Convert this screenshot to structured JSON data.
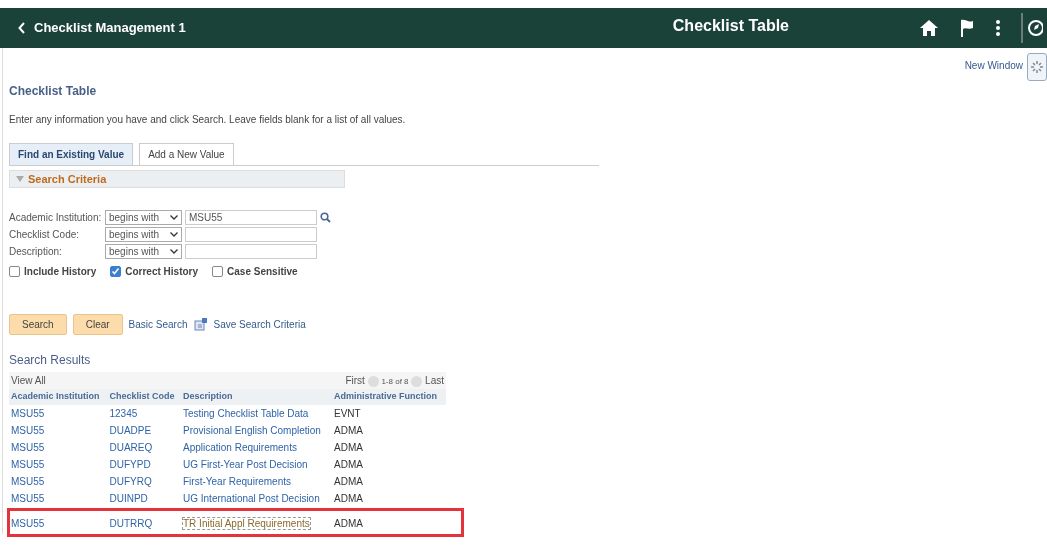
{
  "header": {
    "back_label": "Checklist Management 1",
    "title": "Checklist Table"
  },
  "new_window": "New Window",
  "page": {
    "title": "Checklist Table",
    "instructions": "Enter any information you have and click Search. Leave fields blank for a list of all values."
  },
  "tabs": [
    {
      "label": "Find an Existing Value",
      "selected": true
    },
    {
      "label": "Add a New Value",
      "selected": false
    }
  ],
  "search_criteria": {
    "title": "Search Criteria",
    "expanded": true,
    "fields": [
      {
        "label": "Academic Institution:",
        "operator": "begins with",
        "value": "MSU55",
        "lookup": true
      },
      {
        "label": "Checklist Code:",
        "operator": "begins with",
        "lookup": false
      },
      {
        "label": "Description:",
        "operator": "begins with",
        "lookup": false
      }
    ],
    "checkboxes": [
      {
        "label": "Include History",
        "checked": false
      },
      {
        "label": "Correct History",
        "checked": true
      },
      {
        "label": "Case Sensitive",
        "checked": false
      }
    ],
    "buttons": [
      "Search",
      "Clear"
    ],
    "links": [
      "Basic Search",
      "Save Search Criteria"
    ]
  },
  "results": {
    "title": "Search Results",
    "view_all": "View All",
    "first": "First",
    "range": "1-8 of 8",
    "last": "Last",
    "columns": [
      "Academic Institution",
      "Checklist Code",
      "Description",
      "Administrative Function"
    ],
    "rows": [
      {
        "cells": [
          "MSU55",
          "12345",
          "Testing Checklist Table Data",
          "EVNT"
        ],
        "selected": false
      },
      {
        "cells": [
          "MSU55",
          "DUADPE",
          "Provisional English Completion",
          "ADMA"
        ],
        "selected": false
      },
      {
        "cells": [
          "MSU55",
          "DUAREQ",
          "Application Requirements",
          "ADMA"
        ],
        "selected": false
      },
      {
        "cells": [
          "MSU55",
          "DUFYPD",
          "UG First-Year Post Decision",
          "ADMA"
        ],
        "selected": false
      },
      {
        "cells": [
          "MSU55",
          "DUFYRQ",
          "First-Year Requirements",
          "ADMA"
        ],
        "selected": false
      },
      {
        "cells": [
          "MSU55",
          "DUINPD",
          "UG International Post Decision",
          "ADMA"
        ],
        "selected": false
      },
      {
        "cells": [
          "MSU55",
          "DUTRRQ",
          "TR Initial Appl Requirements",
          "ADMA"
        ],
        "selected": true
      }
    ]
  }
}
